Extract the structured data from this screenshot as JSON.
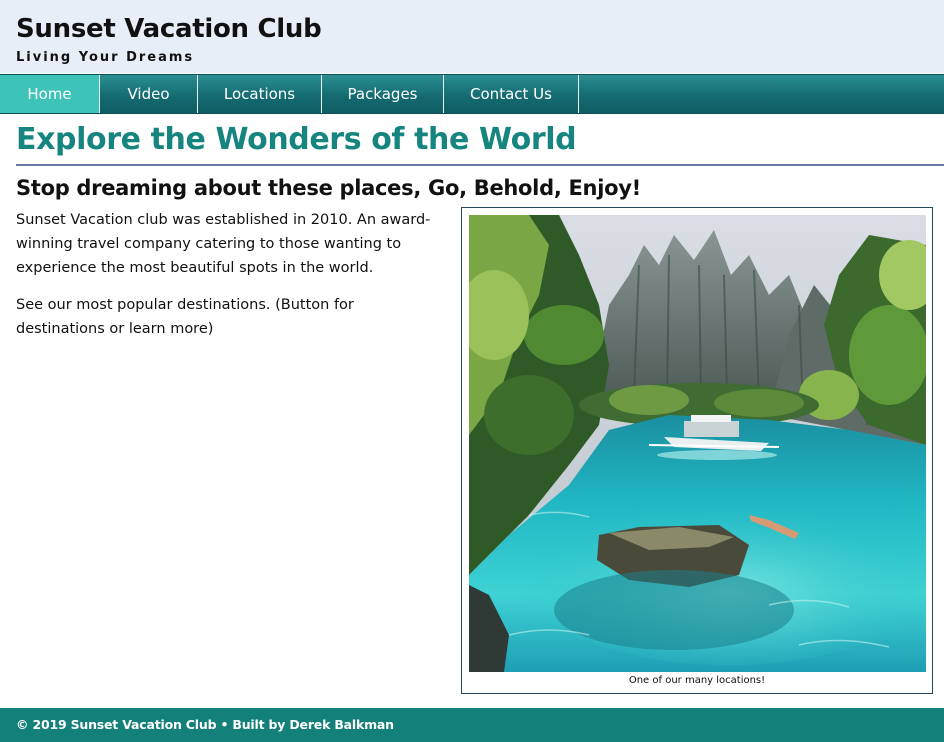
{
  "header": {
    "title": "Sunset Vacation Club",
    "tagline": "Living Your Dreams"
  },
  "nav": {
    "items": [
      {
        "label": "Home",
        "active": true
      },
      {
        "label": "Video",
        "active": false
      },
      {
        "label": "Locations",
        "active": false
      },
      {
        "label": "Packages",
        "active": false
      },
      {
        "label": "Contact Us",
        "active": false
      }
    ]
  },
  "main": {
    "title": "Explore the Wonders of the World",
    "subheading": "Stop dreaming about these places, Go, Behold, Enjoy!",
    "intro": "Sunset Vacation club was established in 2010. An award-winning travel company catering to those wanting to experience the most beautiful spots in the world.",
    "cta_text": "See our most popular destinations. (Button for destinations or learn more)",
    "figure": {
      "caption": "One of our many locations!"
    }
  },
  "footer": {
    "text": "© 2019 Sunset Vacation Club • Built by Derek Balkman"
  },
  "colors": {
    "header_bg": "#e8eef8",
    "nav_bg": "#13696e",
    "nav_active": "#3ec3b8",
    "title_teal": "#16857f",
    "footer_bg": "#14807a"
  }
}
